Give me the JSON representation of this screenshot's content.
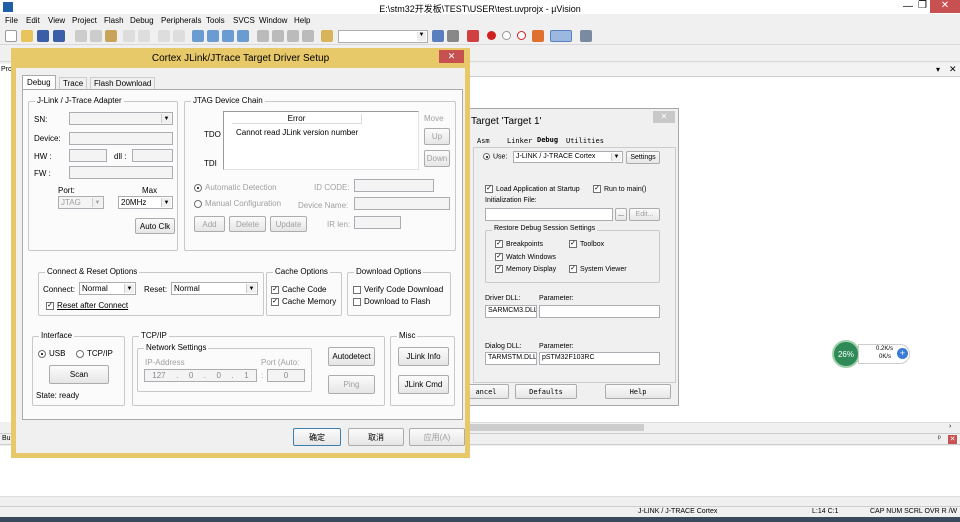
{
  "window": {
    "title": "E:\\stm32开发板\\TEST\\USER\\test.uvprojx - µVision"
  },
  "menu": [
    "File",
    "Edit",
    "View",
    "Project",
    "Flash",
    "Debug",
    "Peripherals",
    "Tools",
    "SVCS",
    "Window",
    "Help"
  ],
  "left_panel": {
    "label": "Pro"
  },
  "bottom_panel": {
    "label": "Bu"
  },
  "status": {
    "debugger": "J-LINK / J-TRACE Cortex",
    "position": "L:14 C:1",
    "flags": "CAP  NUM  SCRL  OVR  R /W"
  },
  "widget": {
    "percent": "26%",
    "up": "0.2K/s",
    "down": "0K/s"
  },
  "bg_dialog": {
    "title": "Target 'Target 1'",
    "tabs": [
      "Asm",
      "Linker",
      "Debug",
      "Utilities"
    ],
    "use_label": "Use:",
    "use_value": "J-LINK / J-TRACE Cortex",
    "settings_btn": "Settings",
    "load_app": "Load Application at Startup",
    "run_main": "Run to main()",
    "init_file_label": "Initialization File:",
    "browse_btn": "...",
    "edit_btn": "Edit...",
    "restore_group": "Restore Debug Session Settings",
    "breakpoints": "Breakpoints",
    "toolbox": "Toolbox",
    "watch": "Watch Windows",
    "memory": "Memory Display",
    "sysviewer": "System Viewer",
    "driver_dll_label": "Driver DLL:",
    "driver_param_label": "Parameter:",
    "driver_dll": "SARMCM3.DLL",
    "driver_param": "",
    "dialog_dll_label": "Dialog DLL:",
    "dialog_param_label": "Parameter:",
    "dialog_dll": "TARMSTM.DLL",
    "dialog_param": "pSTM32F103RC",
    "cancel_btn": "ancel",
    "defaults_btn": "Defaults",
    "help_btn": "Help"
  },
  "dialog": {
    "title": "Cortex JLink/JTrace Target Driver Setup",
    "tabs": [
      "Debug",
      "Trace",
      "Flash Download"
    ],
    "adapter": {
      "group": "J-Link / J-Trace Adapter",
      "sn": "SN:",
      "device": "Device:",
      "hw": "HW :",
      "dll": "dll :",
      "fw": "FW :",
      "port": "Port:",
      "max": "Max",
      "port_value": "JTAG",
      "max_value": "20MHz",
      "auto_clk": "Auto Clk"
    },
    "jtag": {
      "group": "JTAG Device Chain",
      "tdo": "TDO",
      "tdi": "TDI",
      "col_error": "Error",
      "error_text": "Cannot read JLink version number",
      "move": "Move",
      "up": "Up",
      "down": "Down",
      "auto_detect": "Automatic Detection",
      "manual_config": "Manual Configuration",
      "id_code": "ID CODE:",
      "device_name": "Device Name:",
      "ir_len": "IR len:",
      "add": "Add",
      "delete": "Delete",
      "update": "Update"
    },
    "connect": {
      "group": "Connect & Reset Options",
      "connect_label": "Connect:",
      "connect_value": "Normal",
      "reset_label": "Reset:",
      "reset_value": "Normal",
      "reset_after": "Reset after Connect"
    },
    "cache": {
      "group": "Cache Options",
      "cache_code": "Cache Code",
      "cache_memory": "Cache Memory"
    },
    "download": {
      "group": "Download Options",
      "verify": "Verify Code Download",
      "download_flash": "Download to Flash"
    },
    "interface": {
      "group": "Interface",
      "usb": "USB",
      "tcpip": "TCP/IP",
      "scan": "Scan",
      "state": "State: ready"
    },
    "tcp": {
      "group": "TCP/IP",
      "net_group": "Network Settings",
      "ip_label": "IP-Address",
      "port_label": "Port (Auto:",
      "ip": [
        "127",
        "0",
        "0",
        "1"
      ],
      "port": "0",
      "autodetect": "Autodetect",
      "ping": "Ping"
    },
    "misc": {
      "group": "Misc",
      "jlink_info": "JLink Info",
      "jlink_cmd": "JLink Cmd"
    },
    "ok": "确定",
    "cancel": "取消",
    "apply": "应用(A)"
  },
  "colors": {
    "dialog_border": "#e7c96a",
    "close_red": "#c75050",
    "widget_green": "#2e8b57"
  }
}
